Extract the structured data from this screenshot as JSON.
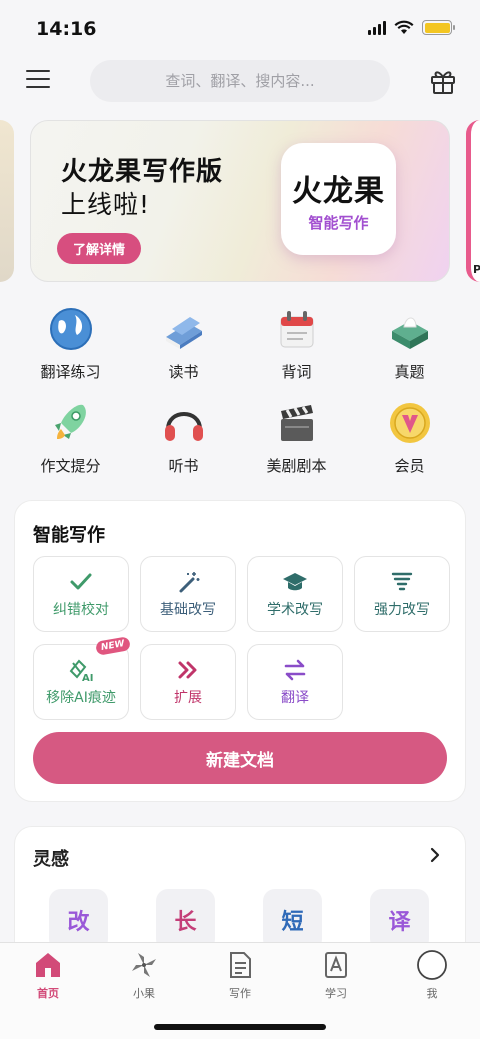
{
  "status_bar": {
    "time": "14:16"
  },
  "header": {
    "search_placeholder": "查词、翻译、搜内容..."
  },
  "banner": {
    "title": "火龙果写作版",
    "subtitle": "上线啦!",
    "button_label": "了解详情",
    "logo_main": "火龙果",
    "logo_sub": "智能写作",
    "peek_right_char": "P"
  },
  "features": [
    {
      "label": "翻译练习",
      "icon": "globe-icon"
    },
    {
      "label": "读书",
      "icon": "book-icon"
    },
    {
      "label": "背词",
      "icon": "calendar-icon"
    },
    {
      "label": "真题",
      "icon": "tissue-box-icon"
    },
    {
      "label": "作文提分",
      "icon": "rocket-icon"
    },
    {
      "label": "听书",
      "icon": "headphones-icon"
    },
    {
      "label": "美剧剧本",
      "icon": "clapperboard-icon"
    },
    {
      "label": "会员",
      "icon": "vip-badge-icon"
    }
  ],
  "writing": {
    "title": "智能写作",
    "buttons": [
      {
        "label": "纠错校对",
        "color": "#3f9a6a",
        "icon": "check-icon"
      },
      {
        "label": "基础改写",
        "color": "#3d5f7a",
        "icon": "magic-wand-icon"
      },
      {
        "label": "学术改写",
        "color": "#2f6d6a",
        "icon": "graduation-cap-icon"
      },
      {
        "label": "强力改写",
        "color": "#2f6d6a",
        "icon": "tornado-icon"
      },
      {
        "label": "移除AI痕迹",
        "color": "#3f9a6a",
        "icon": "ai-eraser-icon",
        "badge": "NEW"
      },
      {
        "label": "扩展",
        "color": "#c0356a",
        "icon": "double-chevron-icon"
      },
      {
        "label": "翻译",
        "color": "#8a4cc8",
        "icon": "swap-arrows-icon"
      }
    ],
    "create_label": "新建文档"
  },
  "inspiration": {
    "title": "灵感",
    "items": [
      {
        "label": "改",
        "color": "#9a58d8"
      },
      {
        "label": "长",
        "color": "#c43e78"
      },
      {
        "label": "短",
        "color": "#2f6ab8"
      },
      {
        "label": "译",
        "color": "#9a58d8"
      }
    ]
  },
  "tabbar": {
    "tabs": [
      {
        "label": "首页",
        "icon": "home-icon",
        "active": true
      },
      {
        "label": "小果",
        "icon": "pinwheel-icon"
      },
      {
        "label": "写作",
        "icon": "document-icon"
      },
      {
        "label": "学习",
        "icon": "study-book-icon"
      },
      {
        "label": "我",
        "icon": "profile-circle-icon"
      }
    ]
  },
  "colors": {
    "accent": "#d65982",
    "background": "#f6f6f8"
  }
}
